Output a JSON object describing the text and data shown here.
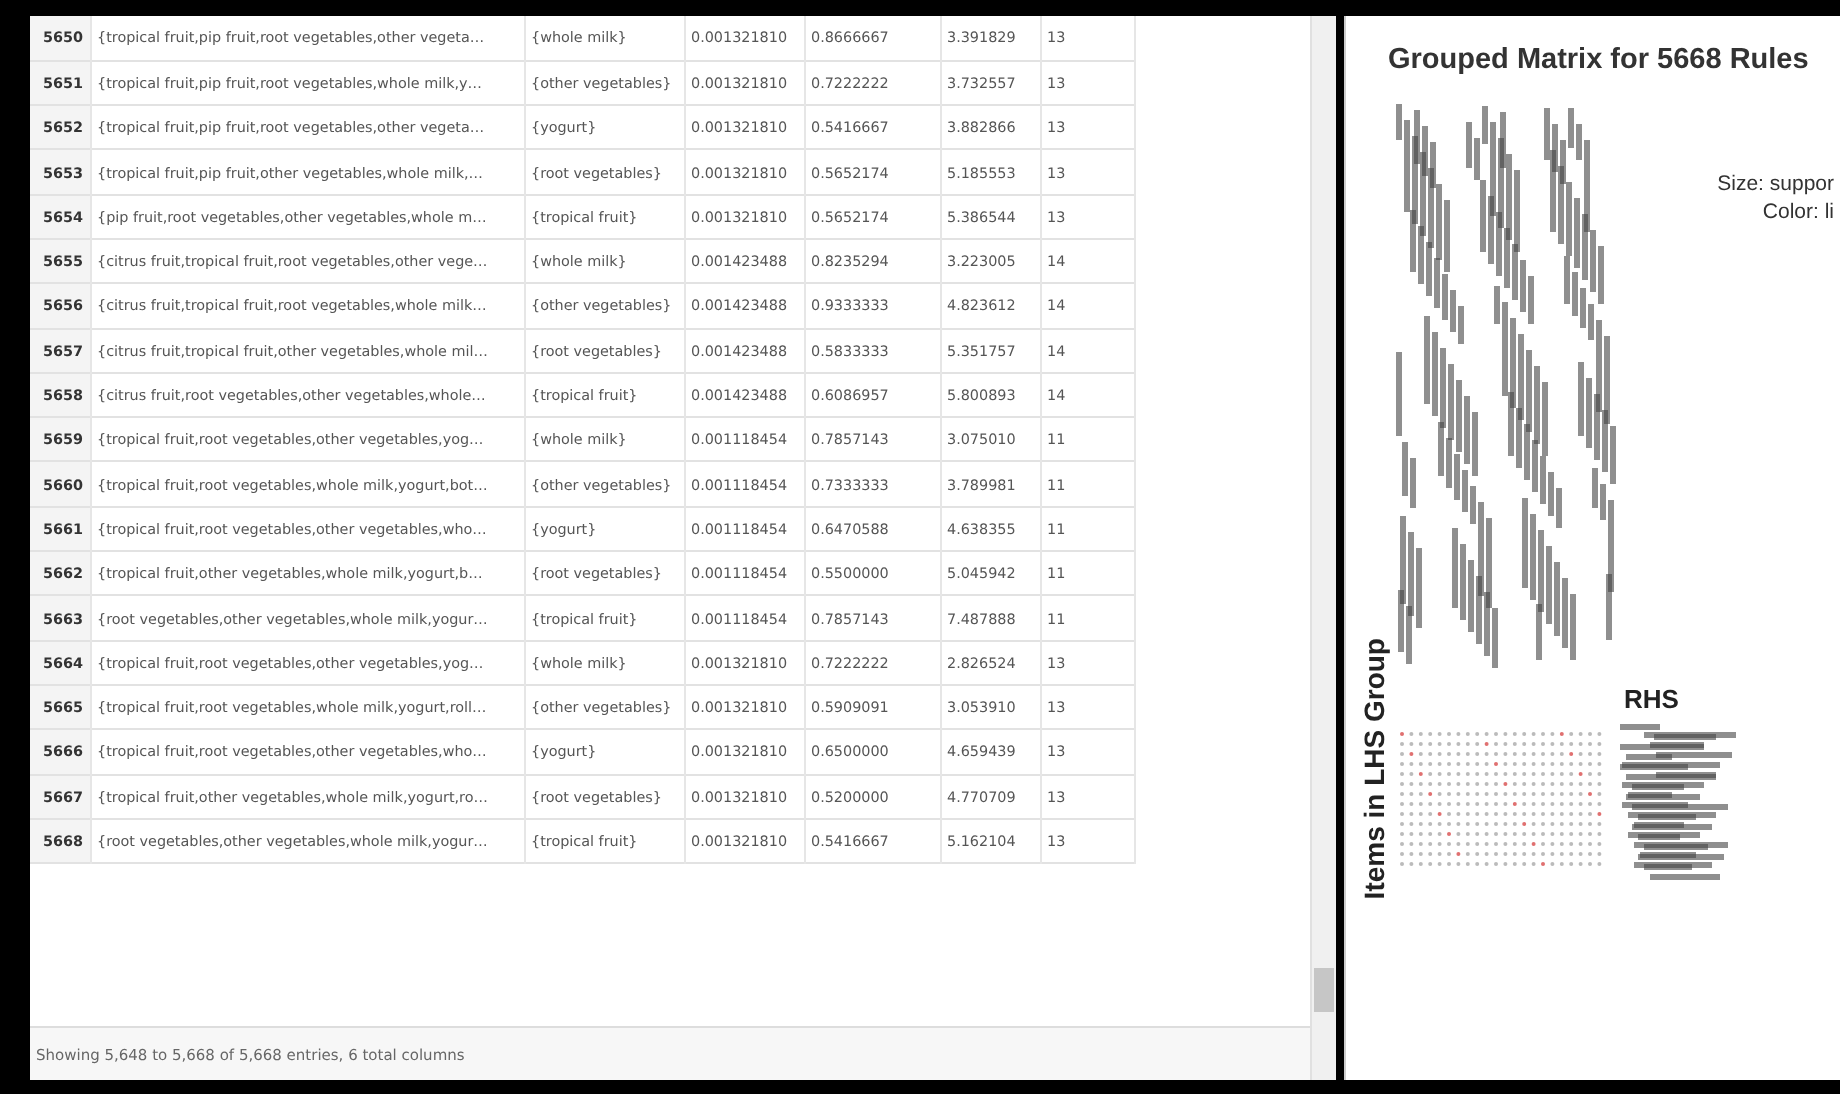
{
  "table": {
    "rows": [
      [
        "5650",
        "{tropical fruit,pip fruit,root vegetables,other vegeta…",
        "{whole milk}",
        "0.001321810",
        "0.8666667",
        "3.391829",
        "13"
      ],
      [
        "5651",
        "{tropical fruit,pip fruit,root vegetables,whole milk,y…",
        "{other vegetables}",
        "0.001321810",
        "0.7222222",
        "3.732557",
        "13"
      ],
      [
        "5652",
        "{tropical fruit,pip fruit,root vegetables,other vegeta…",
        "{yogurt}",
        "0.001321810",
        "0.5416667",
        "3.882866",
        "13"
      ],
      [
        "5653",
        "{tropical fruit,pip fruit,other vegetables,whole milk,…",
        "{root vegetables}",
        "0.001321810",
        "0.5652174",
        "5.185553",
        "13"
      ],
      [
        "5654",
        "{pip fruit,root vegetables,other vegetables,whole m…",
        "{tropical fruit}",
        "0.001321810",
        "0.5652174",
        "5.386544",
        "13"
      ],
      [
        "5655",
        "{citrus fruit,tropical fruit,root vegetables,other vege…",
        "{whole milk}",
        "0.001423488",
        "0.8235294",
        "3.223005",
        "14"
      ],
      [
        "5656",
        "{citrus fruit,tropical fruit,root vegetables,whole milk…",
        "{other vegetables}",
        "0.001423488",
        "0.9333333",
        "4.823612",
        "14"
      ],
      [
        "5657",
        "{citrus fruit,tropical fruit,other vegetables,whole mil…",
        "{root vegetables}",
        "0.001423488",
        "0.5833333",
        "5.351757",
        "14"
      ],
      [
        "5658",
        "{citrus fruit,root vegetables,other vegetables,whole…",
        "{tropical fruit}",
        "0.001423488",
        "0.6086957",
        "5.800893",
        "14"
      ],
      [
        "5659",
        "{tropical fruit,root vegetables,other vegetables,yog…",
        "{whole milk}",
        "0.001118454",
        "0.7857143",
        "3.075010",
        "11"
      ],
      [
        "5660",
        "{tropical fruit,root vegetables,whole milk,yogurt,bot…",
        "{other vegetables}",
        "0.001118454",
        "0.7333333",
        "3.789981",
        "11"
      ],
      [
        "5661",
        "{tropical fruit,root vegetables,other vegetables,who…",
        "{yogurt}",
        "0.001118454",
        "0.6470588",
        "4.638355",
        "11"
      ],
      [
        "5662",
        "{tropical fruit,other vegetables,whole milk,yogurt,b…",
        "{root vegetables}",
        "0.001118454",
        "0.5500000",
        "5.045942",
        "11"
      ],
      [
        "5663",
        "{root vegetables,other vegetables,whole milk,yogur…",
        "{tropical fruit}",
        "0.001118454",
        "0.7857143",
        "7.487888",
        "11"
      ],
      [
        "5664",
        "{tropical fruit,root vegetables,other vegetables,yog…",
        "{whole milk}",
        "0.001321810",
        "0.7222222",
        "2.826524",
        "13"
      ],
      [
        "5665",
        "{tropical fruit,root vegetables,whole milk,yogurt,roll…",
        "{other vegetables}",
        "0.001321810",
        "0.5909091",
        "3.053910",
        "13"
      ],
      [
        "5666",
        "{tropical fruit,root vegetables,other vegetables,who…",
        "{yogurt}",
        "0.001321810",
        "0.6500000",
        "4.659439",
        "13"
      ],
      [
        "5667",
        "{tropical fruit,other vegetables,whole milk,yogurt,ro…",
        "{root vegetables}",
        "0.001321810",
        "0.5200000",
        "4.770709",
        "13"
      ],
      [
        "5668",
        "{root vegetables,other vegetables,whole milk,yogur…",
        "{tropical fruit}",
        "0.001321810",
        "0.5416667",
        "5.162104",
        "13"
      ]
    ],
    "footer": "Showing 5,648 to 5,668 of 5,668 entries, 6 total columns"
  },
  "plot": {
    "title": "Grouped Matrix for 5668 Rules",
    "y_label": "Items in LHS Group",
    "x_label": "RHS",
    "legend": [
      "Size: suppor",
      "Color: li"
    ]
  }
}
